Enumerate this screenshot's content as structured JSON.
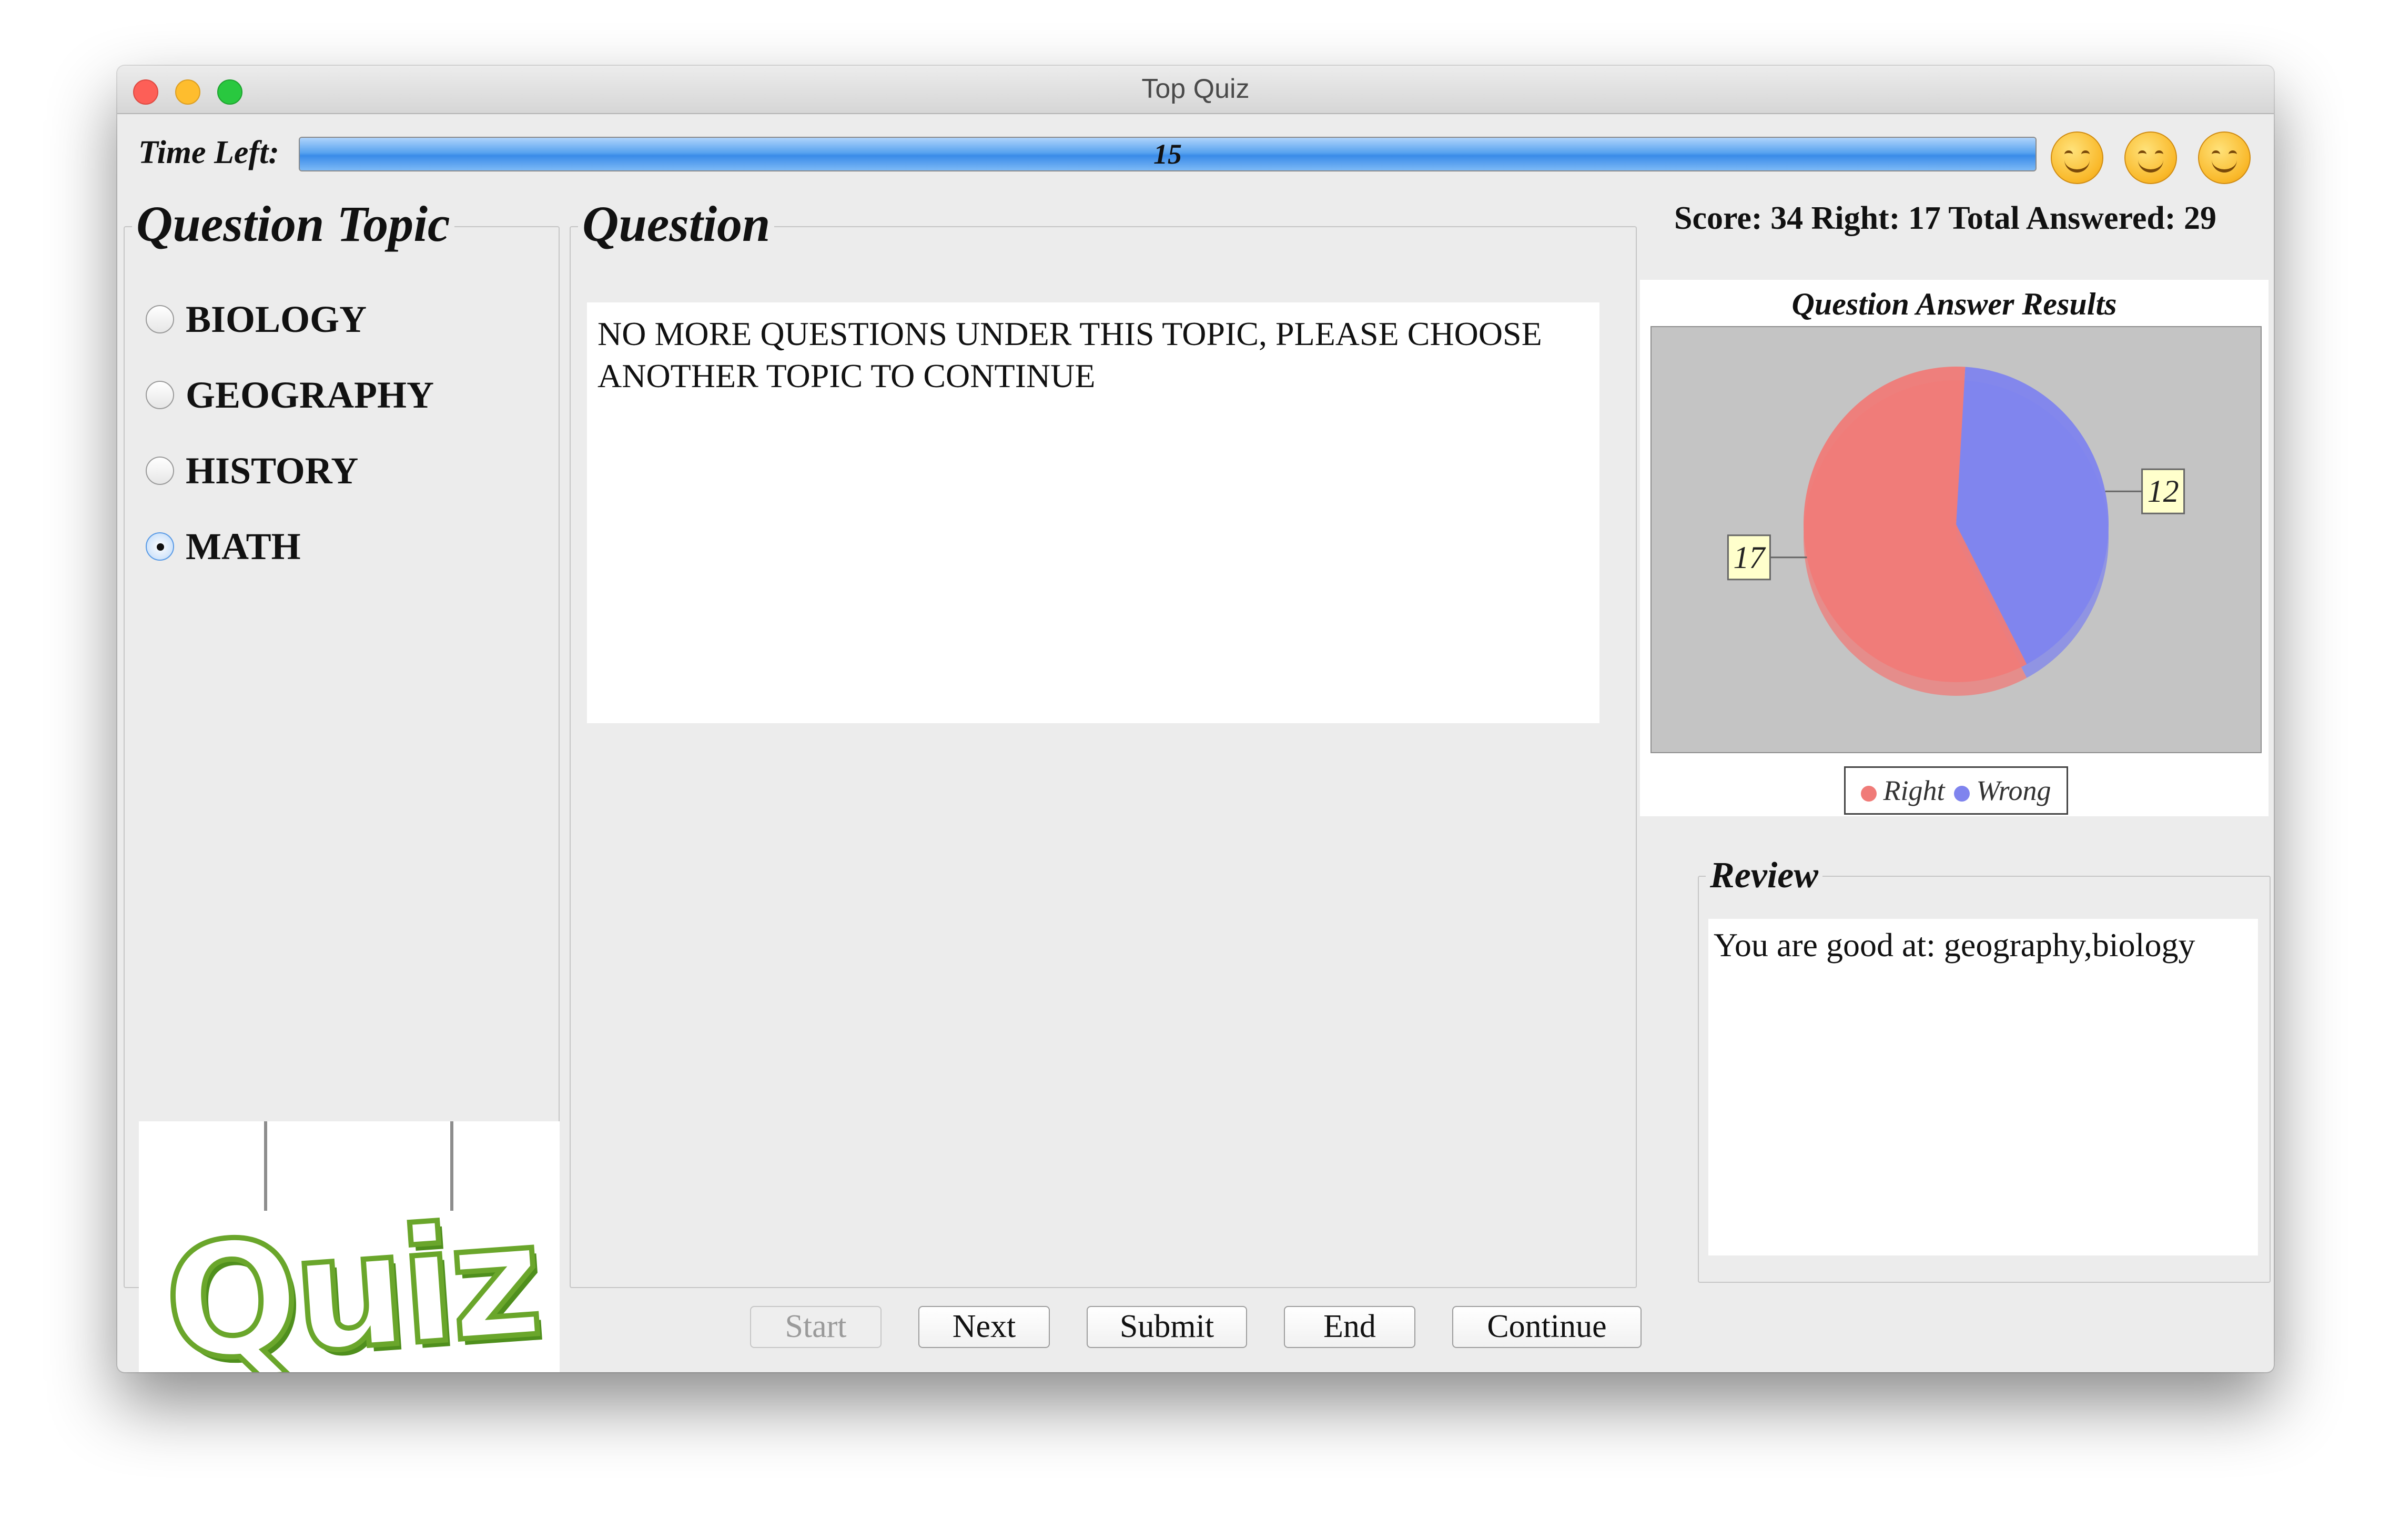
{
  "window": {
    "title": "Top Quiz"
  },
  "timer": {
    "label": "Time Left:",
    "value": "15",
    "fraction": 1.0
  },
  "topics": {
    "title": "Question Topic",
    "options": [
      {
        "label": "BIOLOGY",
        "checked": false
      },
      {
        "label": "GEOGRAPHY",
        "checked": false
      },
      {
        "label": "HISTORY",
        "checked": false
      },
      {
        "label": "MATH",
        "checked": true
      }
    ],
    "logo_text": "Quiz"
  },
  "question": {
    "title": "Question",
    "lines": [
      "NO MORE QUESTIONS UNDER THIS TOPIC, PLEASE CHOOSE",
      "ANOTHER TOPIC TO CONTINUE"
    ]
  },
  "score": {
    "text": "Score: 34 Right: 17 Total Answered: 29"
  },
  "chart_data": {
    "type": "pie",
    "title": "Question Answer Results",
    "slices": [
      {
        "label": "Right",
        "value": 17,
        "color": "#f07b78"
      },
      {
        "label": "Wrong",
        "value": 12,
        "color": "#7f84ee"
      }
    ],
    "data_labels": [
      "17",
      "12"
    ],
    "legend": {
      "entries": [
        "Right",
        "Wrong"
      ],
      "placement": "bottom"
    }
  },
  "review": {
    "title": "Review",
    "text": "You are good at: geography,biology"
  },
  "buttons": {
    "start": "Start",
    "next": "Next",
    "submit": "Submit",
    "end": "End",
    "continue": "Continue"
  },
  "colors": {
    "progress_fill": "#4a97ec",
    "right": "#f07b78",
    "wrong": "#7f84ee"
  }
}
